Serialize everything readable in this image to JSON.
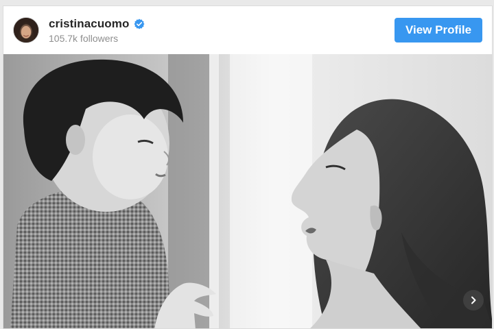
{
  "post": {
    "username": "cristinacuomo",
    "followers": "105.7k followers",
    "view_profile_label": "View Profile",
    "verified": true
  },
  "icons": {
    "verified": "verified-badge-icon",
    "next": "chevron-right-icon",
    "avatar": "profile-avatar"
  },
  "colors": {
    "accent": "#3897f0",
    "verified": "#3897f0",
    "username": "#262626",
    "secondary_text": "#8e8e8e"
  },
  "media": {
    "style": "black-and-white photograph",
    "has_carousel": true
  }
}
